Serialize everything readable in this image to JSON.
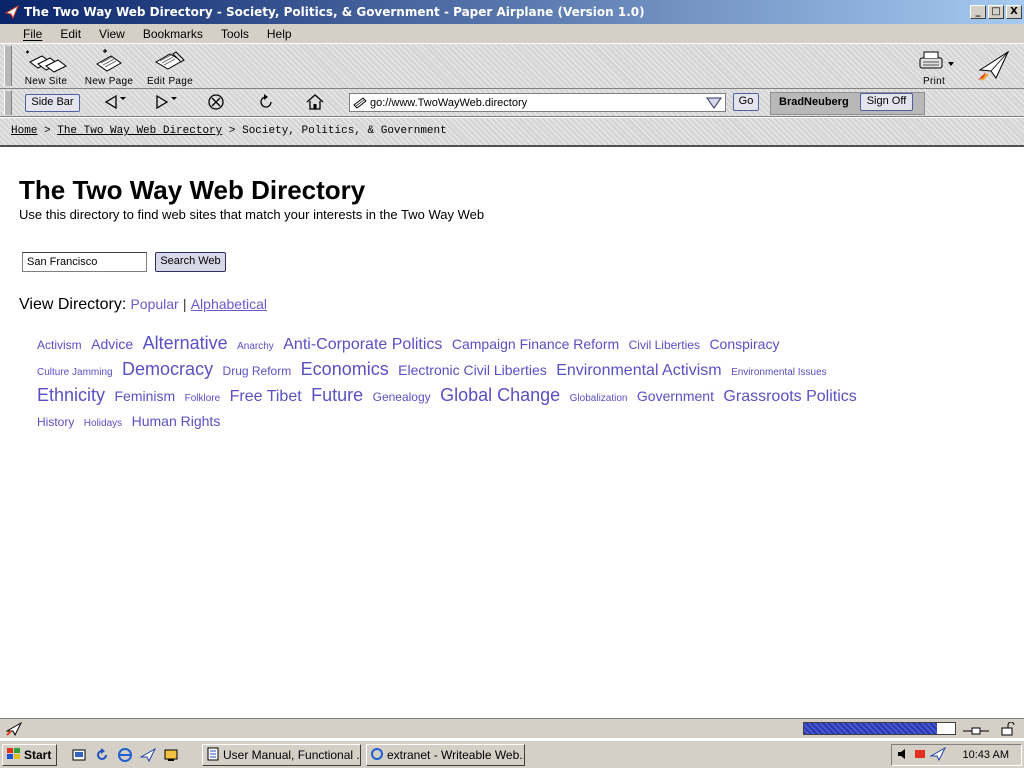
{
  "window": {
    "title": "The Two Way Web Directory - Society, Politics, & Government - Paper Airplane (Version 1.0)",
    "buttons": {
      "minimize": "_",
      "maximize": "□",
      "close": "X"
    }
  },
  "menu": {
    "items": [
      {
        "label": "File"
      },
      {
        "label": "Edit"
      },
      {
        "label": "View"
      },
      {
        "label": "Bookmarks"
      },
      {
        "label": "Tools"
      },
      {
        "label": "Help"
      }
    ]
  },
  "toolbar": {
    "new_site": "New Site",
    "new_page": "New Page",
    "edit_page": "Edit Page",
    "print": "Print",
    "side_bar": "Side Bar",
    "go": "Go",
    "username": "BradNeuberg",
    "sign_off": "Sign Off",
    "url": "go://www.TwoWayWeb.directory"
  },
  "breadcrumb": {
    "home": "Home",
    "sep": ">",
    "directory": "The Two Way Web Directory",
    "current": "Society, Politics, & Government"
  },
  "main": {
    "title": "The Two Way Web Directory",
    "subtitle": "Use this directory to find web sites that match your interests in the Two Way Web",
    "search_value": "San Francisco",
    "search_button": "Search Web",
    "view_directory_label": "View Directory:",
    "view_popular": "Popular",
    "view_sep": "|",
    "view_alphabetical": "Alphabetical",
    "tags": [
      {
        "label": "Activism",
        "size": 2
      },
      {
        "label": "Advice",
        "size": 3
      },
      {
        "label": "Alternative",
        "size": 5
      },
      {
        "label": "Anarchy",
        "size": 1
      },
      {
        "label": "Anti-Corporate Politics",
        "size": 4
      },
      {
        "label": "Campaign Finance Reform",
        "size": 3
      },
      {
        "label": "Civil Liberties",
        "size": 2
      },
      {
        "label": "Conspiracy",
        "size": 3
      },
      {
        "label": "Culture Jamming",
        "size": 1
      },
      {
        "label": "Democracy",
        "size": 5
      },
      {
        "label": "Drug Reform",
        "size": 2
      },
      {
        "label": "Economics",
        "size": 5
      },
      {
        "label": "Electronic Civil Liberties",
        "size": 3
      },
      {
        "label": "Environmental Activism",
        "size": 4
      },
      {
        "label": "Environmental Issues",
        "size": 1
      },
      {
        "label": "Ethnicity",
        "size": 5
      },
      {
        "label": "Feminism",
        "size": 3
      },
      {
        "label": "Folklore",
        "size": 1
      },
      {
        "label": "Free Tibet",
        "size": 4
      },
      {
        "label": "Future",
        "size": 5
      },
      {
        "label": "Genealogy",
        "size": 2
      },
      {
        "label": "Global Change",
        "size": 5
      },
      {
        "label": "Globalization",
        "size": 1
      },
      {
        "label": "Government",
        "size": 3
      },
      {
        "label": "Grassroots Politics",
        "size": 4
      },
      {
        "label": "History",
        "size": 2
      },
      {
        "label": "Holidays",
        "size": 1
      },
      {
        "label": "Human Rights",
        "size": 3
      }
    ]
  },
  "status": {
    "progress": 0.88
  },
  "taskbar": {
    "start": "Start",
    "items": [
      {
        "label": "User Manual, Functional ..."
      },
      {
        "label": "extranet - Writeable Web..."
      }
    ],
    "clock": "10:43 AM"
  },
  "colors": {
    "title_bar_start": "#0a246a",
    "title_bar_end": "#a6caf0",
    "tag_link": "#5b4fc4",
    "chrome": "#d4d0c8"
  }
}
